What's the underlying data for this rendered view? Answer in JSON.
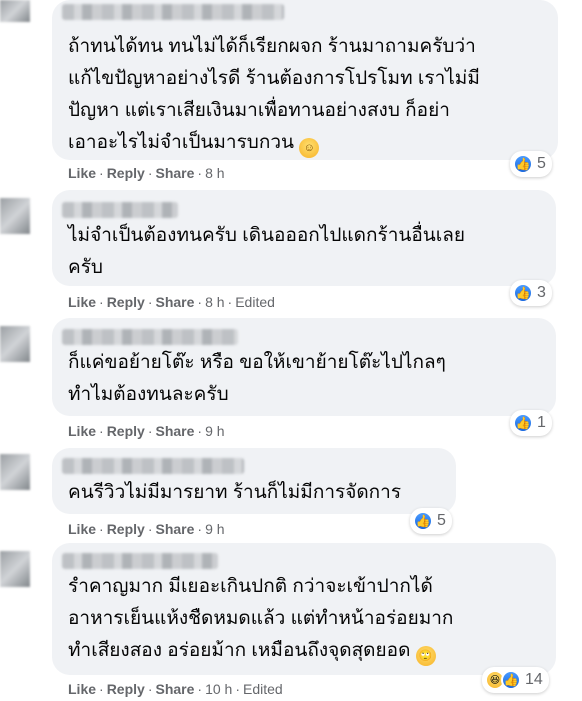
{
  "comments": [
    {
      "text": "ถ้าทนได้ทน ทนไม่ได้ก็เรียกผจก ร้านมาถามครับว่า\nแก้ไขปัญหาอย่างไรดี ร้านต้องการโปรโมท เราไม่มี\nปัญหา แต่เราเสียเงินมาเพื่อทานอย่างสงบ ก็อย่า\nเอาอะไรไม่จำเป็นมารบกวน",
      "emoji": "grinning-face-emoji",
      "like": "Like",
      "reply": "Reply",
      "share": "Share",
      "time": "8 h",
      "edited": "",
      "reactions": {
        "icons": [
          "like-icon"
        ],
        "count": "5"
      }
    },
    {
      "text": "ไม่จำเป็นต้องทนครับ เดินอออกไปแดกร้านอื่นเลย\nครับ",
      "emoji": "",
      "like": "Like",
      "reply": "Reply",
      "share": "Share",
      "time": "8 h",
      "edited": "Edited",
      "reactions": {
        "icons": [
          "like-icon"
        ],
        "count": "3"
      }
    },
    {
      "text": "ก็แค่ขอย้ายโต๊ะ หรือ ขอให้เขาย้ายโต๊ะไปไกลๆ\nทำไมต้องทนละครับ",
      "emoji": "",
      "like": "Like",
      "reply": "Reply",
      "share": "Share",
      "time": "9 h",
      "edited": "",
      "reactions": {
        "icons": [
          "like-icon"
        ],
        "count": "1"
      }
    },
    {
      "text": "คนรีวิวไม่มีมารยาท ร้านก็ไม่มีการจัดการ",
      "emoji": "",
      "like": "Like",
      "reply": "Reply",
      "share": "Share",
      "time": "9 h",
      "edited": "",
      "reactions": {
        "icons": [
          "like-icon"
        ],
        "count": "5"
      }
    },
    {
      "text": "รำคาญมาก มีเยอะเกินปกติ กว่าจะเข้าปากได้\nอาหารเย็นแห้งชืดหมดแล้ว แต่ทำหน้าอร่อยมาก\nทำเสียงสอง อร่อยม้าก เหมือนถึงจุดสุดยอด",
      "emoji": "rolling-eyes-emoji",
      "like": "Like",
      "reply": "Reply",
      "share": "Share",
      "time": "10 h",
      "edited": "Edited",
      "reactions": {
        "icons": [
          "haha-icon",
          "like-icon"
        ],
        "count": "14"
      }
    }
  ]
}
